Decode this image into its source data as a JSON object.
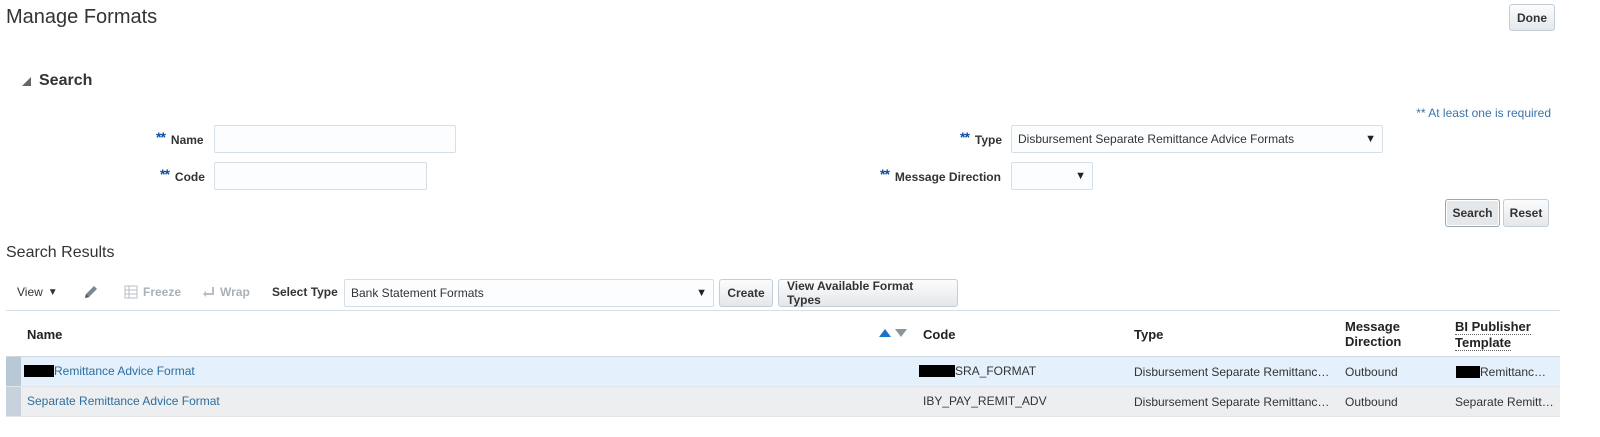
{
  "page": {
    "title": "Manage Formats",
    "done_label": "Done"
  },
  "search": {
    "header": "Search",
    "required_note": "** At least one is required",
    "required_marker": "**",
    "name_label": "Name",
    "name_value": "",
    "code_label": "Code",
    "code_value": "",
    "type_label": "Type",
    "type_value": "Disbursement Separate Remittance Advice Formats",
    "direction_label": "Message Direction",
    "direction_value": "",
    "search_label": "Search",
    "reset_label": "Reset"
  },
  "results": {
    "title": "Search Results",
    "toolbar": {
      "view_label": "View",
      "freeze_label": "Freeze",
      "wrap_label": "Wrap",
      "select_type_label": "Select Type",
      "select_type_value": "Bank Statement Formats",
      "create_label": "Create",
      "view_available_label": "View Available Format Types"
    },
    "columns": {
      "name": "Name",
      "code": "Code",
      "type": "Type",
      "direction_line1": "Message",
      "direction_line2": "Direction",
      "template_line1": "BI Publisher",
      "template_line2": "Template"
    },
    "rows": [
      {
        "name": "Remittance Advice Format",
        "code": "SRA_FORMAT",
        "type": "Disbursement Separate Remittanc…",
        "direction": "Outbound",
        "template": "Remittanc…"
      },
      {
        "name": "Separate Remittance Advice Format",
        "code": "IBY_PAY_REMIT_ADV",
        "type": "Disbursement Separate Remittanc…",
        "direction": "Outbound",
        "template": "Separate Remitt…"
      }
    ]
  },
  "icons": {
    "collapse": "triangle-down-right-icon",
    "view_caret": "caret-down-icon",
    "edit": "pencil-icon",
    "freeze": "freeze-columns-icon",
    "wrap": "wrap-icon",
    "select_caret": "caret-down-icon",
    "sort": "sort-asc-desc-icon"
  },
  "colors": {
    "link": "#2d6e9f",
    "required": "#0a4ea6",
    "selected_row": "#e4f0fb",
    "disabled": "#a9b1b8"
  }
}
